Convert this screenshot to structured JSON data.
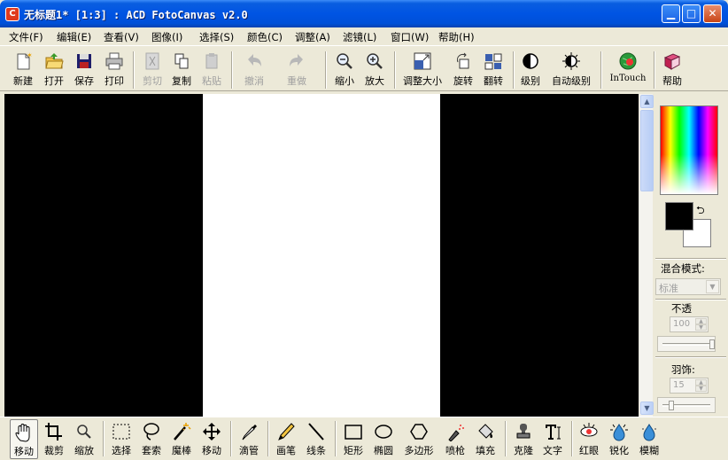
{
  "window": {
    "title": "无标题1* [1:3] : ACD FotoCanvas v2.0",
    "app_icon_glyph": "C"
  },
  "menu": [
    {
      "label": "文件(F)"
    },
    {
      "label": "编辑(E)"
    },
    {
      "label": "查看(V)"
    },
    {
      "label": "图像(I)"
    },
    {
      "label": "选择(S)"
    },
    {
      "label": "颜色(C)"
    },
    {
      "label": "调整(A)"
    },
    {
      "label": "滤镜(L)"
    },
    {
      "label": "窗口(W)"
    },
    {
      "label": "帮助(H)"
    }
  ],
  "toolbar": {
    "new": "新建",
    "open": "打开",
    "save": "保存",
    "print": "打印",
    "cut": "剪切",
    "copy": "复制",
    "paste": "粘贴",
    "undo": "撤消",
    "redo": "重做",
    "zoom_out": "缩小",
    "zoom_in": "放大",
    "resize": "调整大小",
    "rotate": "旋转",
    "flip": "翻转",
    "levels": "级别",
    "auto_levels": "自动级别",
    "intouch": "InTouch",
    "help": "帮助"
  },
  "right_panel": {
    "blend_mode_label": "混合模式:",
    "blend_mode_value": "标准",
    "opacity_label": "不透",
    "opacity_value": "100",
    "feather_label": "羽饰:",
    "feather_value": "15",
    "foreground_color": "#000000",
    "background_color": "#ffffff"
  },
  "bottom_tools": {
    "move": "移动",
    "crop": "裁剪",
    "zoom": "缩放",
    "select": "选择",
    "lasso": "套索",
    "magic_wand": "魔棒",
    "move2": "移动",
    "eyedropper": "滴管",
    "brush": "画笔",
    "line": "线条",
    "rectangle": "矩形",
    "ellipse": "椭圆",
    "polygon": "多边形",
    "airbrush": "喷枪",
    "fill": "填充",
    "clone": "克隆",
    "text": "文字",
    "red_eye": "红眼",
    "sharpen": "锐化",
    "blur": "模糊"
  },
  "colors": {
    "titlebar": "#0054e3",
    "canvas_background": "#000000",
    "page": "#ffffff"
  }
}
